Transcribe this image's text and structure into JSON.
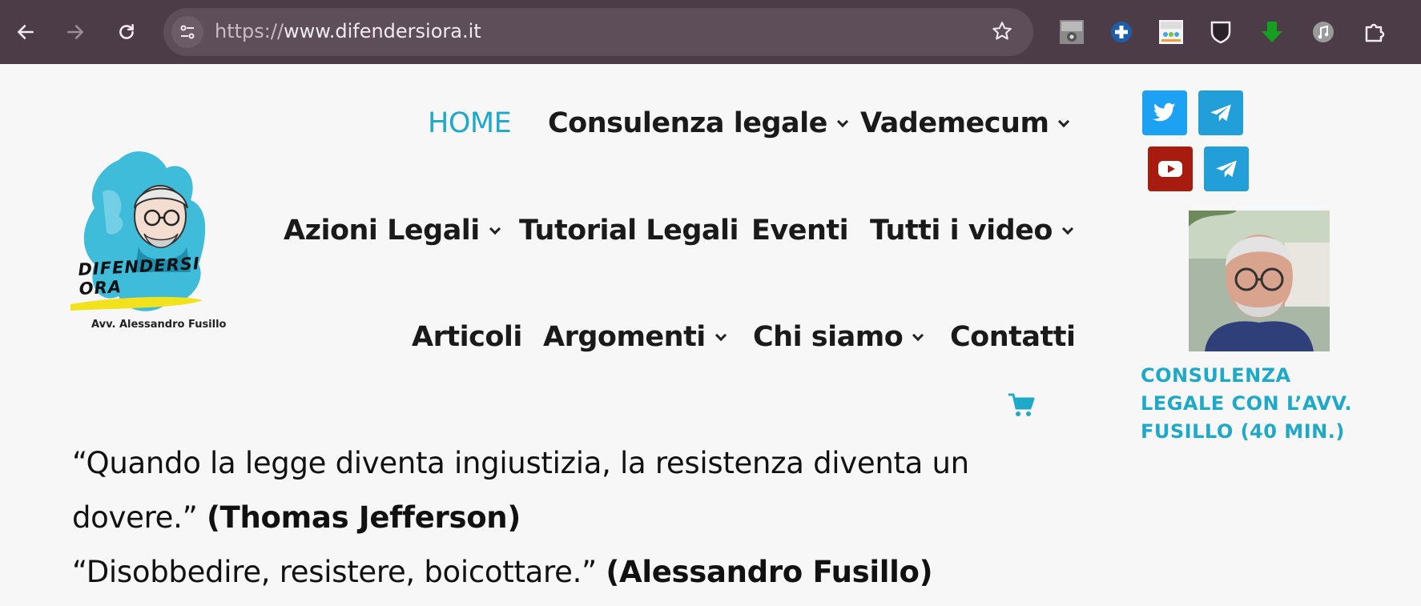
{
  "browser": {
    "url_protocol": "https://",
    "url_host": "www.difendersiora.it",
    "extensions": [
      "tineye-icon",
      "plus-extension-icon",
      "invid-icon",
      "shield-icon",
      "download-arrow-icon",
      "music-icon",
      "puzzle-icon"
    ]
  },
  "logo": {
    "brand": "DIFENDERSI ORA",
    "subtitle": "Avv. Alessandro Fusillo"
  },
  "menu": {
    "row1": [
      {
        "label": "HOME",
        "active": true
      },
      {
        "label": "Consulenza legale"
      },
      {
        "label": "Vademecum"
      }
    ],
    "row2": [
      {
        "label": "Azioni Legali"
      },
      {
        "label": "Tutorial Legali"
      },
      {
        "label": "Eventi"
      },
      {
        "label": "Tutti i video"
      }
    ],
    "row3": [
      {
        "label": "Articoli"
      },
      {
        "label": "Argomenti"
      },
      {
        "label": "Chi siamo"
      },
      {
        "label": "Contatti"
      }
    ]
  },
  "sidebar": {
    "consult_text": "CONSULENZA LEGALE CON L’AVV. FUSILLO (40 MIN.)"
  },
  "quotes": {
    "q1_line1": "“Quando la legge diventa ingiustizia, la resistenza diventa un",
    "q1_line2": "dovere.” ",
    "q1_author": "(Thomas Jefferson)",
    "q2_text": "“Disobbedire, resistere, boicottare.” ",
    "q2_author": "(Alessandro Fusillo)"
  },
  "colors": {
    "accent": "#1fa9c9",
    "chrome_bg": "#4b3c47",
    "twitter": "#1da1f2",
    "telegram": "#229ed9",
    "youtube": "#a81c0f"
  }
}
